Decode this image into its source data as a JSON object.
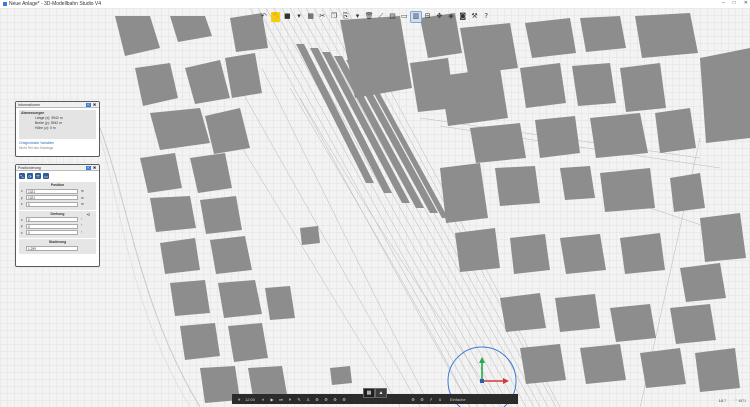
{
  "window": {
    "title": "Neue Anlage* - 3D-Modellbahn Studio V4",
    "minimize": "–",
    "maximize": "□",
    "close": "✕"
  },
  "toolbar": {
    "buttons": [
      {
        "name": "undo-icon",
        "glyph": "↶",
        "state": "normal"
      },
      {
        "name": "pointer-icon",
        "glyph": "✋",
        "state": "active"
      },
      {
        "name": "floppy-icon",
        "glyph": "■",
        "state": "normal"
      },
      {
        "name": "dropdown-icon",
        "glyph": "▾",
        "state": "normal"
      },
      {
        "name": "grid-icon",
        "glyph": "▦",
        "state": "normal"
      },
      {
        "name": "scissors-icon",
        "glyph": "✂",
        "state": "normal"
      },
      {
        "name": "copy-icon",
        "glyph": "❐",
        "state": "normal"
      },
      {
        "name": "paste-icon",
        "glyph": "⎘",
        "state": "normal"
      },
      {
        "name": "dropdown-icon-2",
        "glyph": "▾",
        "state": "normal"
      },
      {
        "name": "trash-icon",
        "glyph": "🗑",
        "state": "normal"
      },
      {
        "name": "track-icon",
        "glyph": "⟋",
        "state": "normal"
      },
      {
        "name": "layers-icon",
        "glyph": "▤",
        "state": "normal"
      },
      {
        "name": "terrain-icon",
        "glyph": "▭",
        "state": "normal"
      },
      {
        "name": "catalog-icon",
        "glyph": "▥",
        "state": "selected"
      },
      {
        "name": "split-icon",
        "glyph": "⊟",
        "state": "normal"
      },
      {
        "name": "move-icon",
        "glyph": "✥",
        "state": "normal"
      },
      {
        "name": "layer-icon",
        "glyph": "◈",
        "state": "normal"
      },
      {
        "name": "camera-icon",
        "glyph": "◙",
        "state": "normal"
      },
      {
        "name": "tools-icon",
        "glyph": "⚒",
        "state": "normal"
      },
      {
        "name": "help-icon",
        "glyph": "?",
        "state": "normal"
      }
    ]
  },
  "info_panel": {
    "title": "Informationen",
    "section_title": "Abmessungen",
    "rows": [
      "Länge (x): 3942 m",
      "Breite (y): 3942 m",
      "Höhe (z): 0 m"
    ],
    "link": "Ortsgestützte Variablen",
    "muted": "Nicht Teil des Katalogs",
    "pin": "⇱",
    "close": "✖"
  },
  "position_panel": {
    "title": "Positionierung",
    "pin": "⇱",
    "close": "✖",
    "tool_icons": [
      "⤡",
      "⟳",
      "⤧",
      "▭"
    ],
    "position": {
      "title": "Position",
      "fields": [
        {
          "axis": "x",
          "value": "1321",
          "unit": "m"
        },
        {
          "axis": "y",
          "value": "1321",
          "unit": "m"
        },
        {
          "axis": "z",
          "value": "0",
          "unit": "m"
        }
      ]
    },
    "rotation": {
      "title": "Drehung",
      "reset": "⟲",
      "fields": [
        {
          "axis": "x",
          "value": "0",
          "unit": "°"
        },
        {
          "axis": "y",
          "value": "0",
          "unit": "°"
        },
        {
          "axis": "z",
          "value": "0",
          "unit": "°"
        }
      ]
    },
    "scale": {
      "title": "Skalierung",
      "value": "1,299"
    }
  },
  "bottom_bar": {
    "time": "12:00",
    "speed": "Einfache",
    "buttons": [
      "☀",
      "⏸",
      "▶",
      "⏭",
      "⏵",
      "✎",
      "⚓",
      "⚙",
      "⚙",
      "⚙",
      "⚙"
    ],
    "right_buttons": [
      "⚙",
      "⚙",
      "𝑓",
      "ℹ"
    ]
  },
  "view_toggle": [
    "▦",
    "▲"
  ],
  "status": {
    "scale_text": "1:8.7",
    "corner_text": "⌃ 4871"
  }
}
